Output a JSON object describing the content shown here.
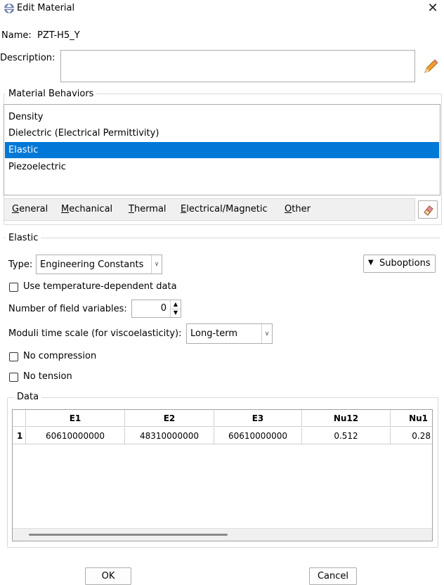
{
  "window": {
    "title": "Edit Material",
    "close_glyph": "✕"
  },
  "name_row": {
    "label": "Name:",
    "value": "PZT-H5_Y"
  },
  "description": {
    "label": "Description:",
    "value": "",
    "edit_icon": "pencil-icon"
  },
  "behaviors": {
    "title": "Material Behaviors",
    "items": [
      {
        "label": "Density",
        "selected": false
      },
      {
        "label": "Dielectric (Electrical Permittivity)",
        "selected": false
      },
      {
        "label": "Elastic",
        "selected": true
      },
      {
        "label": "Piezoelectric",
        "selected": false
      }
    ],
    "menu": [
      {
        "mnemonic": "G",
        "rest": "eneral"
      },
      {
        "mnemonic": "M",
        "rest": "echanical"
      },
      {
        "mnemonic": "T",
        "rest": "hermal"
      },
      {
        "mnemonic": "E",
        "rest": "lectrical/Magnetic"
      },
      {
        "mnemonic": "O",
        "rest": "ther"
      }
    ],
    "eraser_icon": "eraser-icon"
  },
  "elastic": {
    "title": "Elastic",
    "type_label": "Type:",
    "type_value": "Engineering Constants",
    "suboptions_label": "Suboptions",
    "use_temp_label": "Use temperature-dependent data",
    "use_temp_checked": false,
    "field_vars_label": "Number of field variables:",
    "field_vars_value": "0",
    "moduli_label": "Moduli time scale (for viscoelasticity):",
    "moduli_value": "Long-term",
    "no_compression_label": "No compression",
    "no_compression_checked": false,
    "no_tension_label": "No tension",
    "no_tension_checked": false
  },
  "data_table": {
    "title": "Data",
    "columns": [
      "E1",
      "E2",
      "E3",
      "Nu12",
      "Nu1"
    ],
    "rows": [
      {
        "index": "1",
        "cells": [
          "60610000000",
          "48310000000",
          "60610000000",
          "0.512",
          "0.28"
        ]
      }
    ]
  },
  "buttons": {
    "ok": "OK",
    "cancel": "Cancel"
  },
  "colors": {
    "selection": "#0078d7",
    "menubar": "#f0f0f0"
  }
}
